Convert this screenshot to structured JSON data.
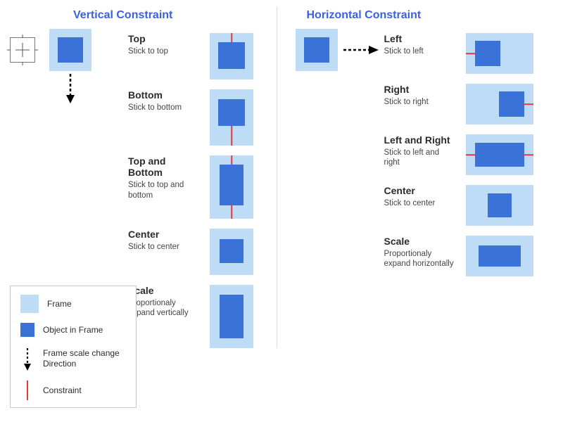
{
  "vertical": {
    "heading": "Vertical Constraint",
    "rows": [
      {
        "title": "Top",
        "desc": "Stick to top"
      },
      {
        "title": "Bottom",
        "desc": "Stick to bottom"
      },
      {
        "title": "Top and Bottom",
        "desc": "Stick to top and bottom"
      },
      {
        "title": "Center",
        "desc": "Stick to center"
      },
      {
        "title": "Scale",
        "desc": "Proportionaly expand vertically"
      }
    ]
  },
  "horizontal": {
    "heading": "Horizontal Constraint",
    "rows": [
      {
        "title": "Left",
        "desc": "Stick to left"
      },
      {
        "title": "Right",
        "desc": "Stick to right"
      },
      {
        "title": "Left and Right",
        "desc": "Stick to left and right"
      },
      {
        "title": "Center",
        "desc": "Stick to center"
      },
      {
        "title": "Scale",
        "desc": "Proportionaly expand horizontally"
      }
    ]
  },
  "legend": {
    "frame": "Frame",
    "object": "Object in Frame",
    "direction": "Frame scale change Direction",
    "constraint": "Constraint"
  }
}
